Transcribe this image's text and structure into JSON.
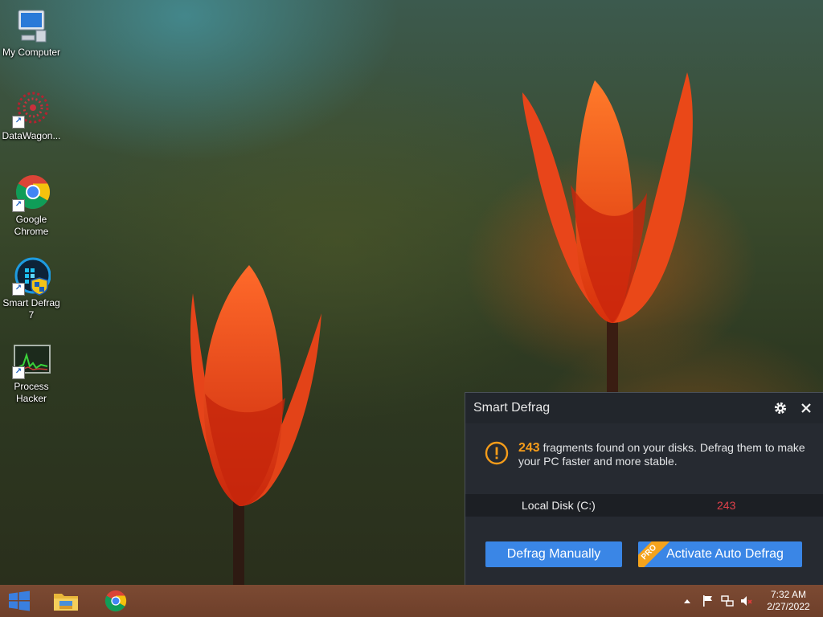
{
  "desktop": {
    "icons": [
      {
        "label": "My Computer",
        "icon": "my-computer-icon"
      },
      {
        "label": "DataWagon...",
        "icon": "datawagon-icon"
      },
      {
        "label": "Google Chrome",
        "icon": "chrome-icon"
      },
      {
        "label": "Smart Defrag 7",
        "icon": "smart-defrag-icon"
      },
      {
        "label": "Process Hacker",
        "icon": "process-hacker-icon"
      }
    ]
  },
  "panel": {
    "title": "Smart Defrag",
    "fragments_count": "243",
    "message": " fragments found on your disks. Defrag them to make your PC faster and more stable.",
    "disk": {
      "name": "Local Disk (C:)",
      "count": "243"
    },
    "defrag_button": "Defrag Manually",
    "auto_button": "Activate Auto Defrag",
    "pro_badge": "PRO",
    "colors": {
      "accent": "#3a86e6",
      "warning": "#f59c1a",
      "count_red": "#e0414a",
      "panel_bg": "#262a31"
    }
  },
  "taskbar": {
    "apps": [
      "windows-start-icon",
      "file-explorer-icon",
      "chrome-icon"
    ],
    "tray": [
      "show-hidden-icons-icon",
      "action-center-flag-icon",
      "network-icon",
      "volume-muted-icon"
    ],
    "time": "7:32 AM",
    "date": "2/27/2022"
  }
}
